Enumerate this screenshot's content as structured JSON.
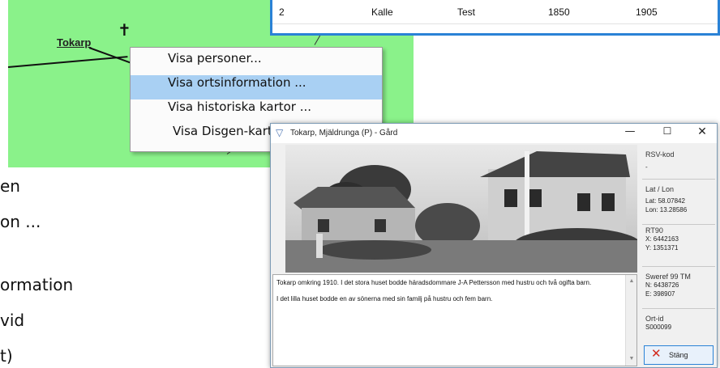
{
  "map": {
    "place_label": "Tokarp",
    "cross_symbol": "✝",
    "background_color": "#8af28a"
  },
  "context_menu": {
    "items": [
      "Visa personer...",
      "Visa ortsinformation ...",
      "Visa historiska kartor ...",
      "Visa Disgen-kart"
    ],
    "selected_index": 1
  },
  "table": {
    "row": [
      "2",
      "Kalle",
      "Test",
      "1850",
      "1905"
    ]
  },
  "background_text": [
    "en",
    "on ...",
    "ormation",
    "vid",
    "t)"
  ],
  "dialog": {
    "title": "Tokarp, Mjäldrunga (P) - Gård",
    "controls": {
      "minimize": "—",
      "maximize": "☐",
      "close": "✕"
    },
    "description_lines": [
      "Tokarp omkring 1910. I det stora huset bodde häradsdommare J-A Pettersson med hustru och två ogifta barn.",
      "I det lilla huset bodde en av sönerna med sin familj på hustru och fem barn."
    ],
    "side": {
      "rsv_label": "RSV-kod",
      "rsv_value": "-",
      "latlon_label": "Lat / Lon",
      "lat": "Lat: 58.07842",
      "lon": "Lon: 13.28586",
      "rt90_label": "RT90",
      "rt90_x": "X: 6442163",
      "rt90_y": "Y: 1351371",
      "sweref_label": "Sweref 99 TM",
      "sweref_n": "N: 6438726",
      "sweref_e": "E: 398907",
      "ortid_label": "Ort-id",
      "ortid_value": "S000099"
    },
    "close_button": "Stäng"
  }
}
